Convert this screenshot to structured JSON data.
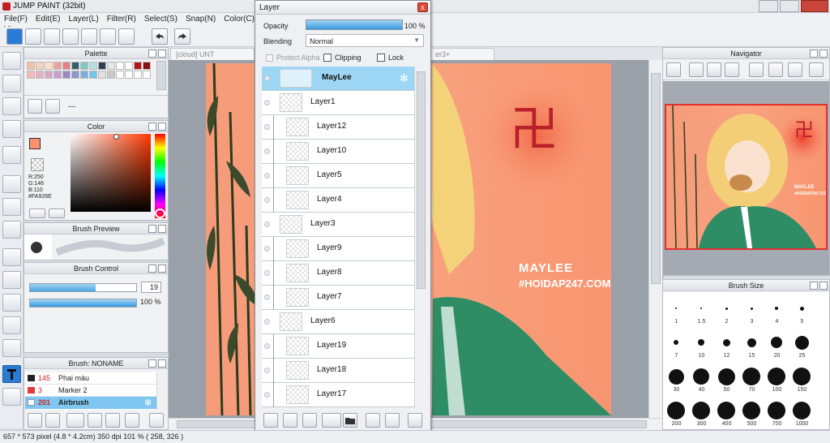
{
  "window": {
    "title": "JUMP PAINT (32bit)"
  },
  "menu": [
    "File(F)",
    "Edit(E)",
    "Layer(L)",
    "Filter(R)",
    "Select(S)",
    "Snap(N)",
    "Color(C)",
    "Vie"
  ],
  "tabs": {
    "doc1": "[cloud] UNT",
    "doc2": "er3+"
  },
  "palette": {
    "title": "Palette",
    "row1": [
      "#f3c0a6",
      "#f8d2b8",
      "#fbe0c8",
      "#f0a0a0",
      "#e87f8a",
      "#3a5f6c",
      "#7ec8c0",
      "#b8e0d8",
      "#2f3f4f",
      "#e6e6e6",
      "#ffffff",
      "#ffffff",
      "#b01818",
      "#8a1010"
    ],
    "row2": [
      "#f6b8b8",
      "#e7b0c0",
      "#d9a6c6",
      "#c7a0cf",
      "#9a88c6",
      "#8c96d0",
      "#7aaee0",
      "#6ec6e8",
      "#e0e0e0",
      "#c8c8c8",
      "#ffffff",
      "#ffffff",
      "#ffffff",
      "#ffffff"
    ],
    "footer": "---"
  },
  "color": {
    "title": "Color",
    "r": "R:250",
    "g": "G:146",
    "b": "B:110",
    "hex": "#FA926E",
    "main": "#FA926E"
  },
  "brush_preview": {
    "title": "Brush Preview"
  },
  "brush_control": {
    "title": "Brush Control",
    "size_value": "19",
    "opacity_value": "100 %",
    "size_fraction": 0.62,
    "opacity_fraction": 1.0
  },
  "brush_list": {
    "title": "Brush: NONAME",
    "items": [
      {
        "num": "145",
        "name": "Phai màu",
        "color": "#222222"
      },
      {
        "num": "3",
        "name": "Marker 2",
        "color": "#e03a3a"
      },
      {
        "num": "201",
        "name": "Airbrush",
        "color": "#ffffff"
      }
    ]
  },
  "layer": {
    "title": "Layer",
    "opacity_label": "Opacity",
    "opacity_value": "100 %",
    "opacity_fraction": 1.0,
    "blending_label": "Blending",
    "blending_value": "Normal",
    "protect_alpha": "Protect Alpha",
    "clipping": "Clipping",
    "lock": "Lock",
    "layers": [
      {
        "name": "MayLee",
        "selected": true,
        "folder": true
      },
      {
        "name": "Layer1"
      },
      {
        "name": "Layer12",
        "clip": true
      },
      {
        "name": "Layer10",
        "clip": true
      },
      {
        "name": "Layer5",
        "clip": true
      },
      {
        "name": "Layer4",
        "clip": true
      },
      {
        "name": "Layer3"
      },
      {
        "name": "Layer9",
        "clip": true
      },
      {
        "name": "Layer8",
        "clip": true
      },
      {
        "name": "Layer7",
        "clip": true
      },
      {
        "name": "Layer6"
      },
      {
        "name": "Layer19",
        "clip": true
      },
      {
        "name": "Layer18",
        "clip": true
      },
      {
        "name": "Layer17",
        "clip": true
      }
    ]
  },
  "artwork": {
    "watermark1": "MAYLEE",
    "watermark2": "#HOIDAP247.COM",
    "symbol": "卍"
  },
  "navigator": {
    "title": "Navigator"
  },
  "brush_size": {
    "title": "Brush Size",
    "sizes": [
      "1",
      "1.5",
      "2",
      "3",
      "4",
      "5",
      "7",
      "10",
      "12",
      "15",
      "20",
      "25",
      "30",
      "40",
      "50",
      "70",
      "100",
      "150",
      "200",
      "300",
      "400",
      "500",
      "700",
      "1000"
    ]
  },
  "status": {
    "text": "657 * 573 pixel  (4.8 * 4.2cm)  350 dpi  101 %  ( 258, 326 )"
  }
}
